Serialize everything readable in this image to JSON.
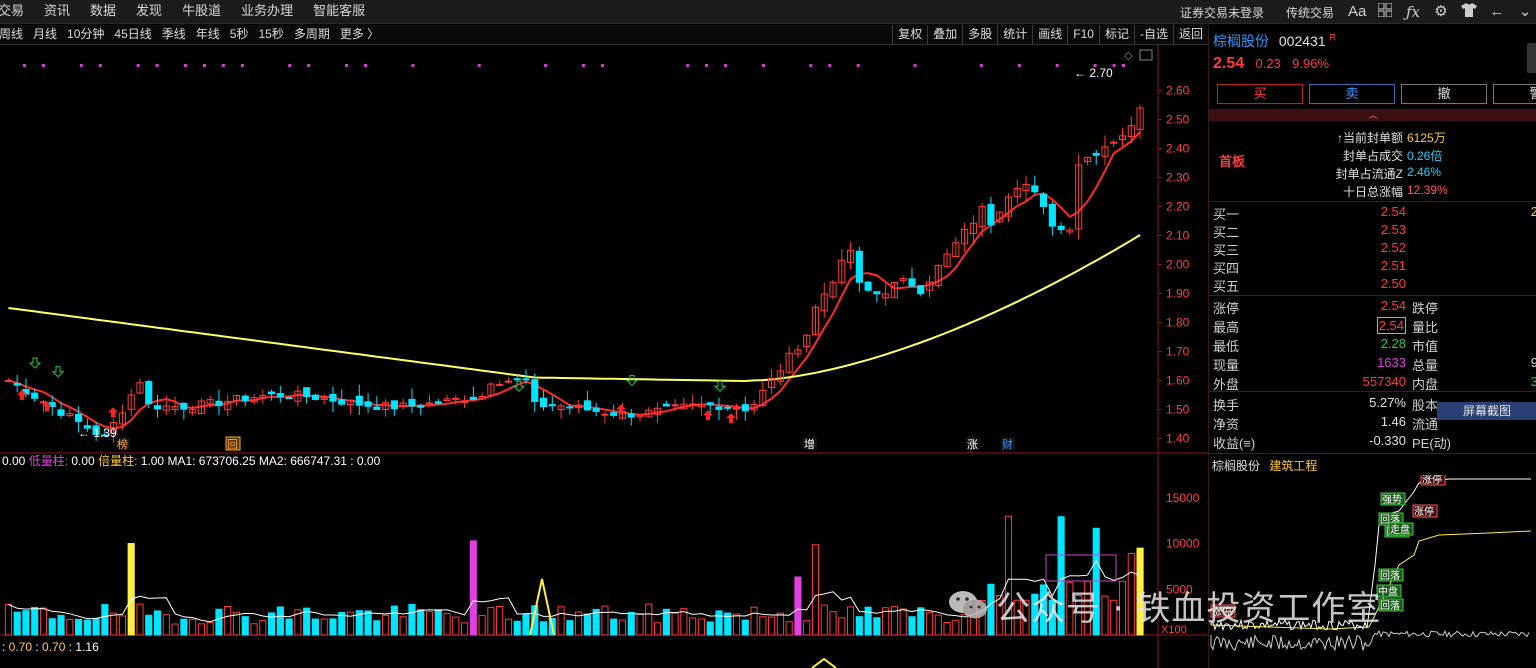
{
  "top_menu": [
    "交易",
    "资讯",
    "数据",
    "发现",
    "牛股道",
    "业务办理",
    "智能客服"
  ],
  "top_right": {
    "login_status": "证券交易未登录",
    "trade_mode": "传统交易",
    "font_icon": "Aa"
  },
  "period_tabs": [
    "周线",
    "月线",
    "10分钟",
    "45日线",
    "季线",
    "年线",
    "5秒",
    "15秒",
    "多周期",
    "更多 〉"
  ],
  "chart_tools": [
    "复权",
    "叠加",
    "多股",
    "统计",
    "画线",
    "F10",
    "标记",
    "-自选",
    "返回"
  ],
  "price_axis": [
    "2.60",
    "2.50",
    "2.40",
    "2.30",
    "2.20",
    "2.10",
    "2.00",
    "1.90",
    "1.80",
    "1.70",
    "1.60",
    "1.50",
    "1.40"
  ],
  "chart_annotations": {
    "high": "2.70",
    "low": "1.39"
  },
  "event_markers": [
    "榜",
    "回",
    "增",
    "涨",
    "财"
  ],
  "volume_legend": {
    "prefix": "0.00",
    "low_label": "低量柱:",
    "low_value": "0.00",
    "double_label": "倍量柱:",
    "double_value": "1.00",
    "ma1": "MA1: 673706.25",
    "ma2": "MA2: 666747.31 : 0.00"
  },
  "volume_axis": [
    "15000",
    "10000",
    "5000",
    "X100"
  ],
  "bottom_indicator": {
    "v1": "0.70",
    "v2": "0.70",
    "v3": "1.16"
  },
  "stock": {
    "name": "棕榈股份",
    "code": "002431",
    "badge": "R",
    "price": "2.54",
    "change": "0.23",
    "change_pct": "9.96%"
  },
  "trade_buttons": [
    "买",
    "卖",
    "撤",
    "警"
  ],
  "limit_up_info": {
    "board_label": "首板",
    "rows": [
      {
        "label": "↑当前封单额",
        "value": "6125万"
      },
      {
        "label": "封单占成交",
        "value": "0.26倍"
      },
      {
        "label": "封单占流通Z",
        "value": "2.46%"
      },
      {
        "label": "十日总涨幅",
        "value": "12.39%"
      }
    ]
  },
  "order_book": [
    {
      "label": "买一",
      "price": "2.54",
      "extra": "2"
    },
    {
      "label": "买二",
      "price": "2.53"
    },
    {
      "label": "买三",
      "price": "2.52"
    },
    {
      "label": "买四",
      "price": "2.51"
    },
    {
      "label": "买五",
      "price": "2.50"
    }
  ],
  "quote_left": [
    {
      "label": "涨停",
      "value": "2.54"
    },
    {
      "label": "最高",
      "value": "2.54"
    },
    {
      "label": "最低",
      "value": "2.28"
    },
    {
      "label": "现量",
      "value": "1633"
    },
    {
      "label": "外盘",
      "value": "557340"
    }
  ],
  "quote_right": [
    {
      "label": "跌停",
      "value": ""
    },
    {
      "label": "量比",
      "value": ""
    },
    {
      "label": "市值",
      "value": ""
    },
    {
      "label": "总量",
      "value": "9"
    },
    {
      "label": "内盘",
      "value": "3"
    }
  ],
  "finance_left": [
    {
      "label": "换手",
      "value": "5.27%"
    },
    {
      "label": "净资",
      "value": "1.46"
    },
    {
      "label": "收益(≡)",
      "value": "-0.330"
    }
  ],
  "finance_right": [
    "股本",
    "流通",
    "PE(动)"
  ],
  "screenshot_button": "屏幕截图",
  "mini_chart": {
    "stock_name": "棕榈股份",
    "sector": "建筑工程",
    "tags": [
      "涨停",
      "强势",
      "回落",
      "涨停",
      "回落",
      "走盘",
      "回落",
      "中盘",
      "回落",
      "涨停"
    ]
  },
  "watermark": "公众号 · 铁血投资工作室",
  "colors": {
    "up": "#ff3b3b",
    "down": "#00e5ff",
    "ma_short": "#ff2a2a",
    "ma_long": "#ffff66",
    "accent_magenta": "#e040e0"
  }
}
